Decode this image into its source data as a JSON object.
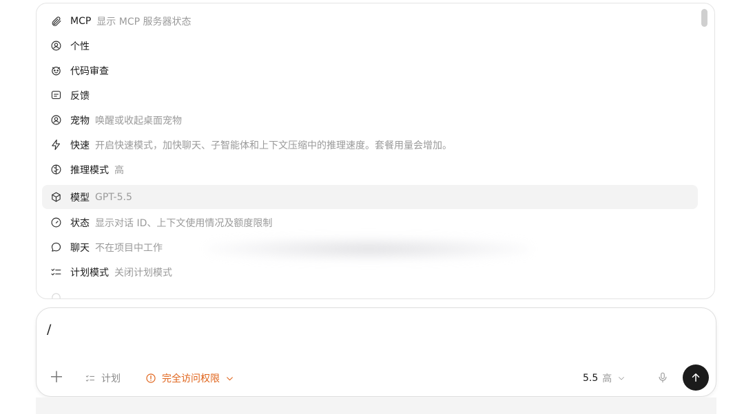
{
  "menu": {
    "items": [
      {
        "name": "MCP",
        "desc": "显示 MCP 服务器状态",
        "icon": "paperclip-icon"
      },
      {
        "name": "个性",
        "desc": "",
        "icon": "persona-icon"
      },
      {
        "name": "代码审查",
        "desc": "",
        "icon": "code-review-icon"
      },
      {
        "name": "反馈",
        "desc": "",
        "icon": "feedback-icon"
      },
      {
        "name": "宠物",
        "desc": "唤醒或收起桌面宠物",
        "icon": "pet-icon"
      },
      {
        "name": "快速",
        "desc": "开启快速模式，加快聊天、子智能体和上下文压缩中的推理速度。套餐用量会增加。",
        "icon": "lightning-icon"
      },
      {
        "name": "推理模式",
        "desc": "高",
        "icon": "brain-icon"
      },
      {
        "name": "模型",
        "desc": "GPT-5.5",
        "icon": "cube-icon"
      },
      {
        "name": "状态",
        "desc": "显示对话 ID、上下文使用情况及额度限制",
        "icon": "gauge-icon"
      },
      {
        "name": "聊天",
        "desc": "不在项目中工作",
        "icon": "chat-bubble-icon"
      },
      {
        "name": "计划模式",
        "desc": "关闭计划模式",
        "icon": "checklist-icon"
      }
    ],
    "selected_index": 7
  },
  "composer": {
    "input_value": "/",
    "plan_label": "计划",
    "access_label": "完全访问权限",
    "model_version": "5.5",
    "model_level": "高"
  },
  "colors": {
    "accent_warning": "#e0641b",
    "send_button": "#1b1b1b",
    "selected_row": "#f3f3f3"
  }
}
